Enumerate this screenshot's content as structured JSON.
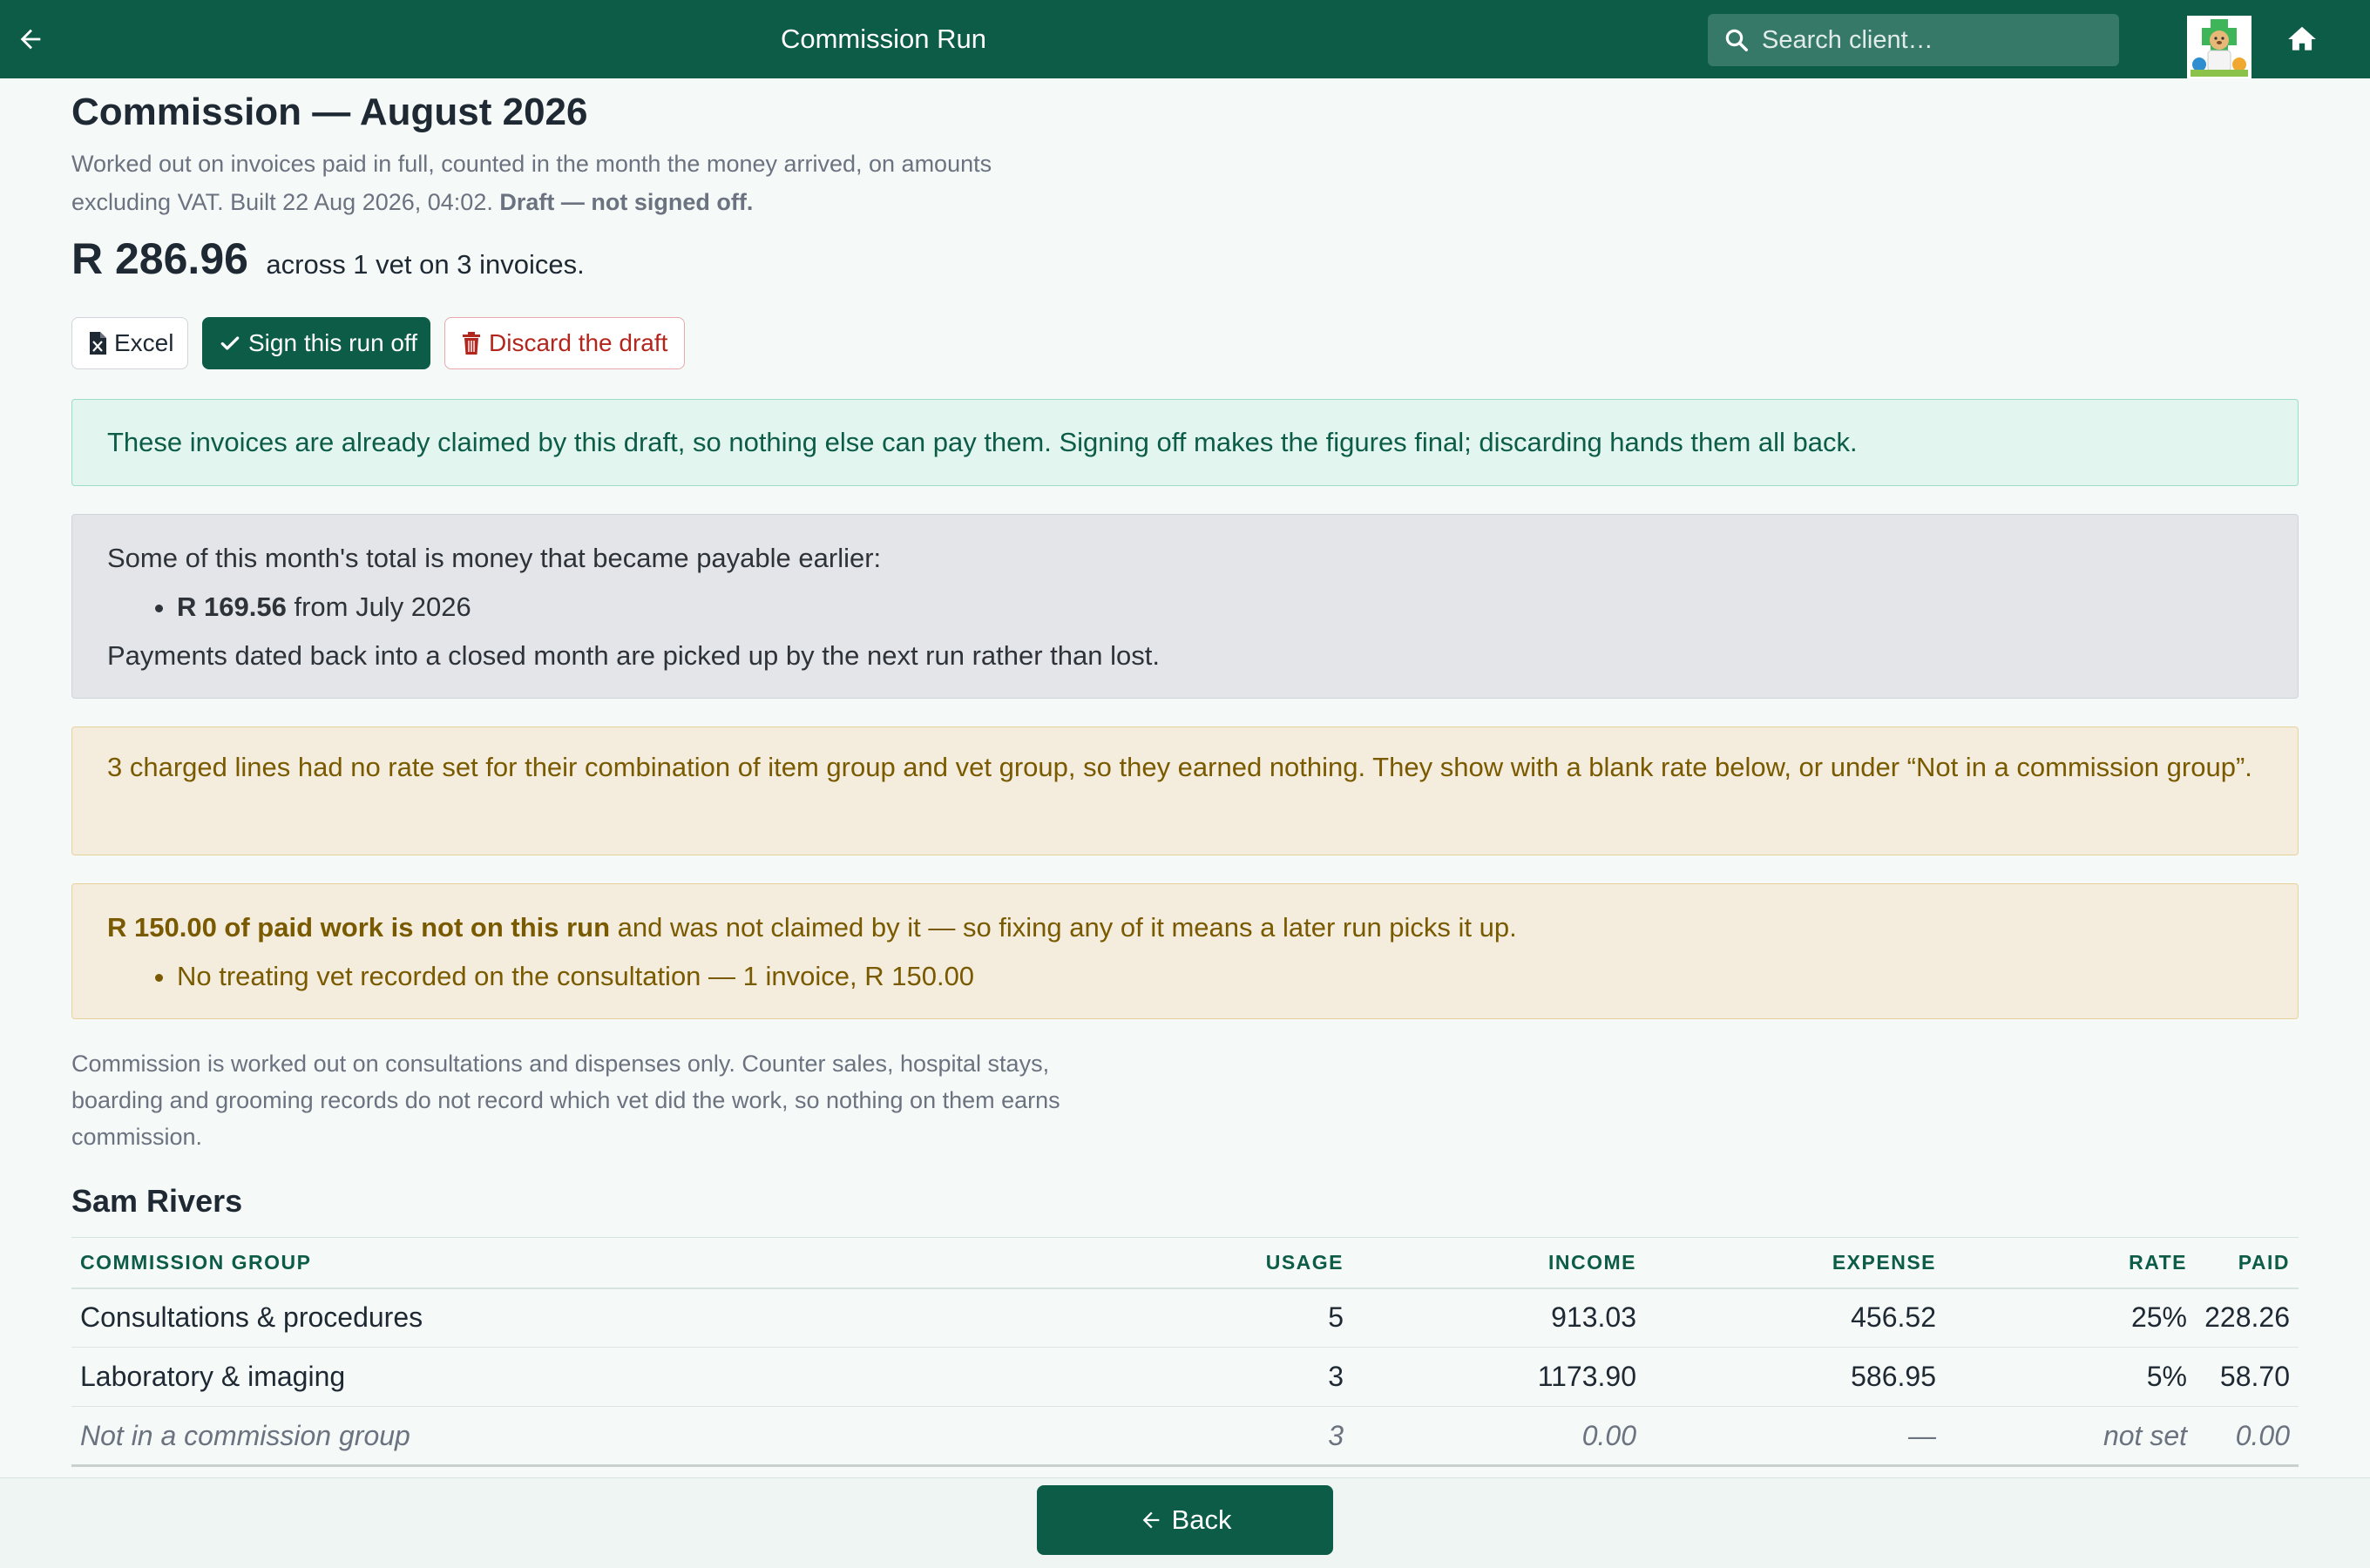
{
  "header": {
    "title": "Commission Run",
    "search_placeholder": "Search client…",
    "icons": [
      "back-arrow-icon",
      "search-icon",
      "clinic-logo",
      "home-icon"
    ],
    "brand_color": "#0c5c48"
  },
  "page": {
    "title": "Commission — August 2026",
    "subtitle_main": "Worked out on invoices paid in full, counted in the month the money arrived, on amounts excluding VAT. Built 22 Aug 2026, 04:02.",
    "subtitle_status": "Draft — not signed off.",
    "total_amount": "R 286.96",
    "total_text": "across 1 vet on 3 invoices."
  },
  "actions": {
    "excel_label": "Excel",
    "sign_label": "Sign this run off",
    "discard_label": "Discard the draft"
  },
  "alerts": {
    "claimed": "These invoices are already claimed by this draft, so nothing else can pay them. Signing off makes the figures final; discarding hands them all back.",
    "earlier_intro": "Some of this month's total is money that became payable earlier:",
    "earlier_items": [
      {
        "amount": "R 169.56",
        "text": "from July 2026"
      }
    ],
    "earlier_note": "Payments dated back into a closed month are picked up by the next run rather than lost.",
    "no_rate": "3 charged lines had no rate set for their combination of item group and vet group, so they earned nothing. They show with a blank rate below, or under “Not in a commission group”.",
    "unclaimed_bold": "R 150.00 of paid work is not on this run",
    "unclaimed_rest": " and was not claimed by it — so fixing any of it means a later run picks it up.",
    "unclaimed_items": [
      "No treating vet recorded on the consultation — 1 invoice, R 150.00"
    ]
  },
  "note": "Commission is worked out on consultations and dispenses only. Counter sales, hospital stays, boarding and grooming records do not record which vet did the work, so nothing on them earns commission.",
  "vet": {
    "name": "Sam Rivers",
    "columns": [
      "Commission group",
      "Usage",
      "Income",
      "Expense",
      "Rate",
      "Paid"
    ],
    "rows": [
      [
        "Consultations & procedures",
        "5",
        "913.03",
        "456.52",
        "25%",
        "228.26"
      ],
      [
        "Laboratory & imaging",
        "3",
        "1173.90",
        "586.95",
        "5%",
        "58.70"
      ],
      [
        "Not in a commission group",
        "3",
        "0.00",
        "—",
        "not set",
        "0.00"
      ]
    ]
  },
  "footer": {
    "back_label": "Back"
  }
}
